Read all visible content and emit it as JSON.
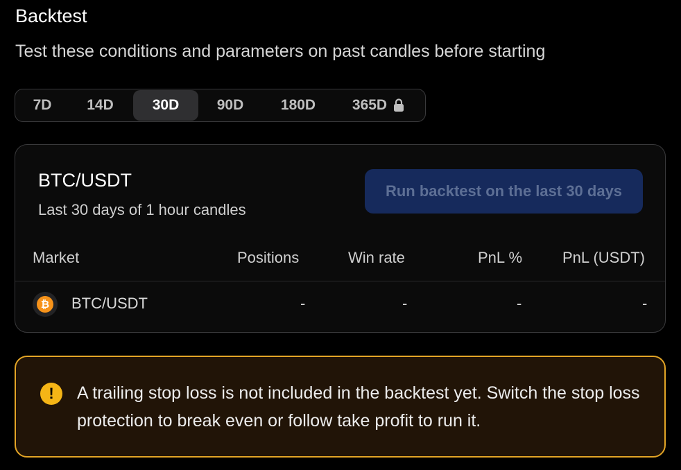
{
  "header": {
    "title": "Backtest",
    "subtitle": "Test these conditions and parameters on past candles before starting"
  },
  "periods": [
    {
      "label": "7D",
      "active": false,
      "locked": false
    },
    {
      "label": "14D",
      "active": false,
      "locked": false
    },
    {
      "label": "30D",
      "active": true,
      "locked": false
    },
    {
      "label": "90D",
      "active": false,
      "locked": false
    },
    {
      "label": "180D",
      "active": false,
      "locked": false
    },
    {
      "label": "365D",
      "active": false,
      "locked": true
    }
  ],
  "card": {
    "pair": "BTC/USDT",
    "range": "Last 30 days of 1 hour candles",
    "run_label": "Run backtest on the last 30 days",
    "columns": [
      "Market",
      "Positions",
      "Win rate",
      "PnL %",
      "PnL (USDT)"
    ],
    "rows": [
      {
        "market": "BTC/USDT",
        "coin_symbol": "₿",
        "positions": "-",
        "win_rate": "-",
        "pnl_pct": "-",
        "pnl_usdt": "-"
      }
    ]
  },
  "alert": {
    "icon": "!",
    "text": "A trailing stop loss is not included in the backtest yet. Switch the stop loss protection to break even or follow take profit to run it."
  },
  "colors": {
    "background": "#000000",
    "button_bg": "#162a5c",
    "alert_border": "#e3a526",
    "alert_bg": "#211407",
    "btc_orange": "#f7931a"
  }
}
